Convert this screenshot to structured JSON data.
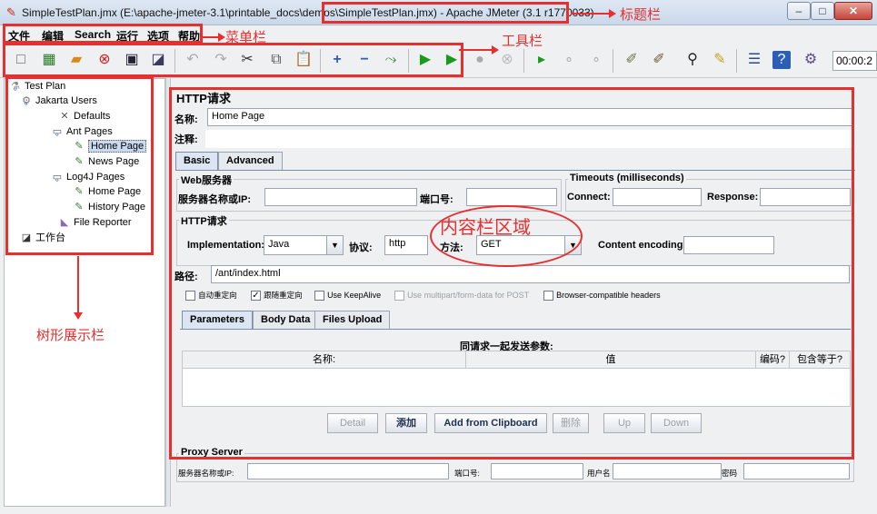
{
  "titlebar": {
    "title_prefix": "SimpleTestPlan.jmx (E:\\apache-jmeter-3.1\\printable_docs\\demos\\",
    "title_highlight": "SimpleTestPlan.jmx) - Apache JMeter (3.1 r1770033)",
    "min": "–",
    "max": "□",
    "close": "✕"
  },
  "menubar": {
    "items": [
      "文件",
      "编辑",
      "Search",
      "运行",
      "选项",
      "帮助"
    ]
  },
  "toolbar": {
    "time": "00:00:2"
  },
  "tree": {
    "test_plan": "Test Plan",
    "jakarta_users": "Jakarta Users",
    "defaults": "Defaults",
    "ant_pages": "Ant Pages",
    "home_page_1": "Home Page",
    "news_page": "News Page",
    "log4j_pages": "Log4J Pages",
    "home_page_2": "Home Page",
    "history_page": "History Page",
    "file_reporter": "File Reporter",
    "workbench": "工作台"
  },
  "content": {
    "header": "HTTP请求",
    "name_label": "名称:",
    "name_value": "Home Page",
    "comment_label": "注释:",
    "tabs": [
      "Basic",
      "Advanced"
    ],
    "web_server": "Web服务器",
    "server_label": "服务器名称或IP:",
    "port_label": "端口号:",
    "timeouts": "Timeouts (milliseconds)",
    "connect_label": "Connect:",
    "response_label": "Response:",
    "http_request": "HTTP请求",
    "impl_label": "Implementation:",
    "impl_value": "Java",
    "protocol_label": "协议:",
    "protocol_value": "http",
    "method_label": "方法:",
    "method_value": "GET",
    "encoding_label": "Content encoding:",
    "path_label": "路径:",
    "path_value": "/ant/index.html",
    "checkboxes": [
      {
        "label": "自动重定向",
        "checked": false
      },
      {
        "label": "跟随重定向",
        "checked": true
      },
      {
        "label": "Use KeepAlive",
        "checked": false
      },
      {
        "label": "Use multipart/form-data for POST",
        "checked": false
      },
      {
        "label": "Browser-compatible headers",
        "checked": false
      }
    ],
    "subtabs": [
      "Parameters",
      "Body Data",
      "Files Upload"
    ],
    "params_title": "同请求一起发送参数:",
    "columns": [
      "名称:",
      "值",
      "编码?",
      "包含等于?"
    ],
    "buttons": [
      "Detail",
      "添加",
      "Add from Clipboard",
      "删除",
      "Up",
      "Down"
    ],
    "proxy": "Proxy Server",
    "proxy_server_label": "服务器名称或IP:",
    "proxy_port_label": "端口号:",
    "proxy_user_label": "用户名",
    "proxy_pass_label": "密码"
  },
  "annotations": {
    "titlebar": "标题栏",
    "menubar": "菜单栏",
    "toolbar": "工具栏",
    "content": "内容栏区域",
    "tree": "树形展示栏"
  }
}
